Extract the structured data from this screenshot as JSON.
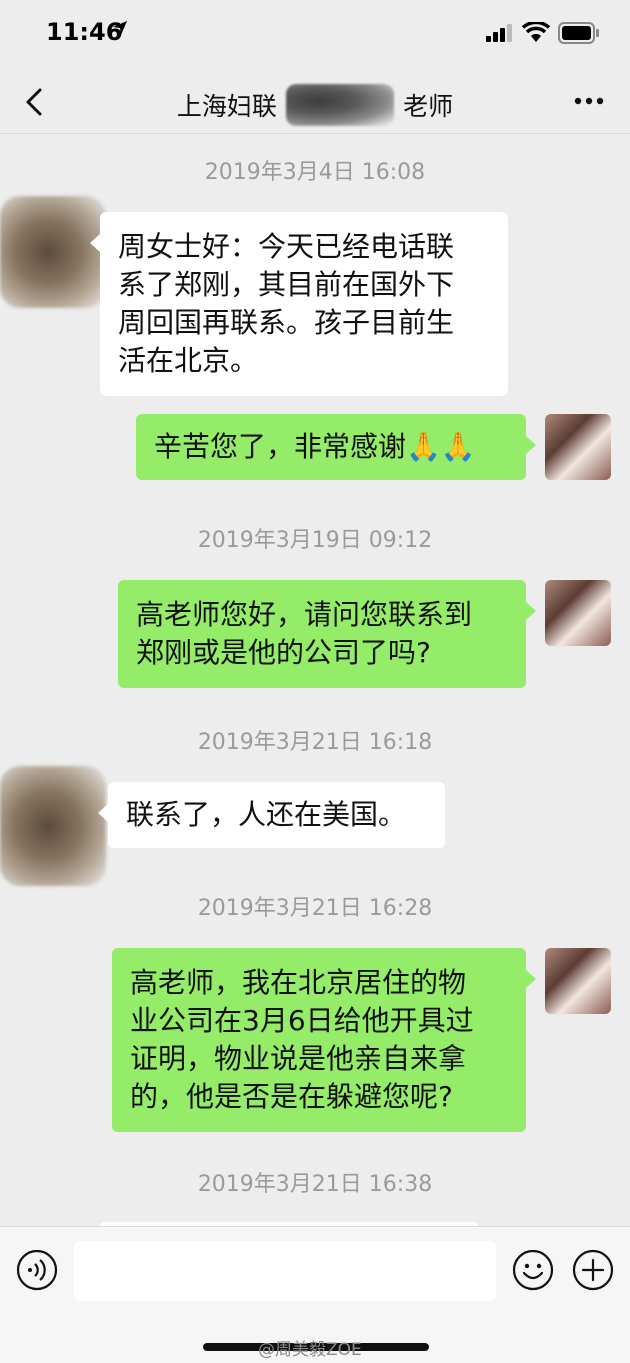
{
  "status_bar": {
    "time": "11:46"
  },
  "nav": {
    "title_left": "上海妇联",
    "title_right": "老师"
  },
  "messages": [
    {
      "timestamp": "2019年3月4日 16:08"
    },
    {
      "text_lines": [
        "周女士好：今天已经电话联",
        "系了郑刚，其目前在国外下",
        "周回国再联系。孩子目前生",
        "活在北京。"
      ]
    },
    {
      "text": "辛苦您了，非常感谢🙏🙏"
    },
    {
      "timestamp": "2019年3月19日 09:12"
    },
    {
      "text_lines": [
        "高老师您好，请问您联系到",
        "郑刚或是他的公司了吗?"
      ]
    },
    {
      "timestamp": "2019年3月21日 16:18"
    },
    {
      "text": "联系了，人还在美国。"
    },
    {
      "timestamp": "2019年3月21日 16:28"
    },
    {
      "text_lines": [
        "高老师，我在北京居住的物",
        "业公司在3月6日给他开具过",
        "证明，物业说是他亲自来拿",
        "的，他是否是在躲避您呢?"
      ]
    },
    {
      "timestamp": "2019年3月21日 16:38"
    }
  ],
  "watermark": "@周美毅ZOE",
  "icons": {
    "back": "chevron-left-icon",
    "more": "more-dots-icon",
    "voice": "voice-icon",
    "emoji": "emoji-icon",
    "plus": "plus-icon"
  }
}
